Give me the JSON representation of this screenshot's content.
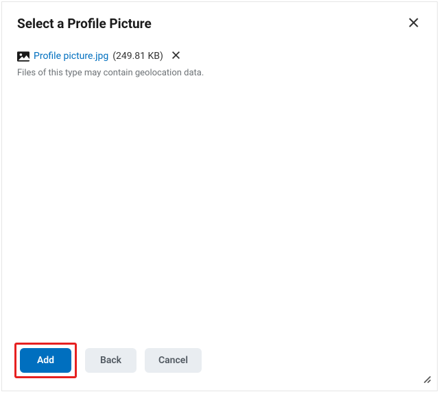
{
  "dialog": {
    "title": "Select a Profile Picture"
  },
  "file": {
    "name": "Profile picture.jpg",
    "size": "(249.81 KB)"
  },
  "info": {
    "geolocation_warning": "Files of this type may contain geolocation data."
  },
  "buttons": {
    "add": "Add",
    "back": "Back",
    "cancel": "Cancel"
  }
}
